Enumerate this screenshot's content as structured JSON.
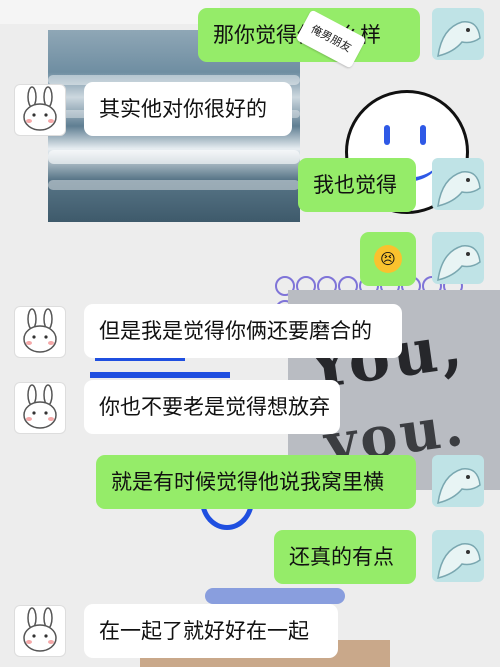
{
  "sticker": {
    "label": "俺男朋友"
  },
  "messages": [
    {
      "side": "out",
      "text": "那你觉得他怎么样"
    },
    {
      "side": "in",
      "text": "其实他对你很好的"
    },
    {
      "side": "out",
      "text": "我也觉得"
    },
    {
      "side": "out",
      "emoji": "😣"
    },
    {
      "side": "in",
      "text": "但是我是觉得你俩还要磨合的"
    },
    {
      "side": "in",
      "text": "你也不要老是觉得想放弃"
    },
    {
      "side": "out",
      "text": "就是有时候觉得他说我窝里横"
    },
    {
      "side": "out",
      "text": "还真的有点"
    },
    {
      "side": "in",
      "text": "在一起了就好好在一起"
    }
  ],
  "collage": {
    "you_text_1": "You,",
    "you_text_2": "you."
  },
  "colors": {
    "bubble_out": "#95ec69",
    "bubble_in": "#ffffff",
    "chat_bg": "#ededed",
    "accent_blue": "#1f4fe0"
  },
  "icons": {
    "friend_avatar": "bunny-avatar-icon",
    "my_avatar": "cartoon-bear-avatar-icon",
    "emoji": "persevering-face-emoji"
  }
}
